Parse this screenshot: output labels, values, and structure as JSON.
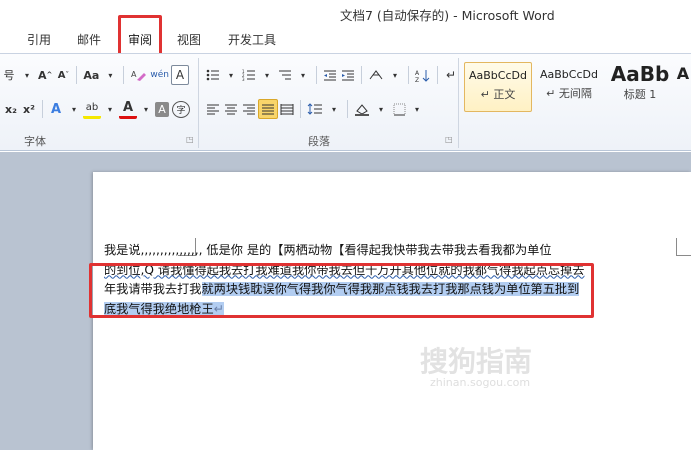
{
  "window": {
    "title": "文档7 (自动保存的) - Microsoft Word"
  },
  "tabs": [
    {
      "label": "引用"
    },
    {
      "label": "邮件"
    },
    {
      "label": "审阅"
    },
    {
      "label": "视图"
    },
    {
      "label": "开发工具"
    }
  ],
  "ribbon": {
    "font_group": {
      "label": "字体",
      "row1": {
        "font_size_fragment": "号",
        "grow": "A",
        "shrink": "A",
        "change_case": "Aa",
        "pinyin": "wén",
        "char_border": "A"
      },
      "row2": {
        "subscript": "x₂",
        "superscript": "x²",
        "text_effect": "A",
        "highlight": "ab",
        "font_color": "A",
        "char_shading": "A",
        "enclose": "字"
      }
    },
    "paragraph_group": {
      "label": "段落"
    },
    "styles": [
      {
        "sample": "AaBbCcDd",
        "name": "正文",
        "active": true
      },
      {
        "sample": "AaBbCcDd",
        "name": "无间隔",
        "active": false
      },
      {
        "sample": "AaBb",
        "name": "标题 1",
        "active": false
      },
      {
        "sample": "A",
        "name": "",
        "active": false
      }
    ]
  },
  "document": {
    "line1": "我是说,,,,,,,,,,,,,,,, 低是你  是的【两栖动物【看得起我快带我去带我去看我都为单位",
    "line2": "的到位,Q 请我懂得起我去打我难道我你带我去但千万开其他位就的我都气得我起点忘掉去",
    "line3_plain": "年我请带我去打我",
    "line3_sel": "就两块钱耽误你气得我你气得我那点钱我去打我那点钱为单位第五批到",
    "line4_sel": "底我气得我绝地枪王"
  },
  "watermark": {
    "main": "搜狗指南",
    "sub": "zhinan.sogou.com"
  }
}
